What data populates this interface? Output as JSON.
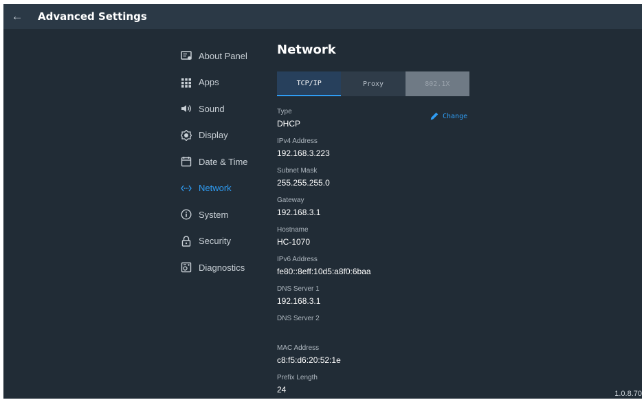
{
  "header": {
    "title": "Advanced Settings",
    "back_icon": "arrow-left-icon"
  },
  "sidebar": {
    "items": [
      {
        "label": "About Panel",
        "icon": "about-panel-icon"
      },
      {
        "label": "Apps",
        "icon": "apps-grid-icon"
      },
      {
        "label": "Sound",
        "icon": "speaker-icon"
      },
      {
        "label": "Display",
        "icon": "brightness-icon"
      },
      {
        "label": "Date & Time",
        "icon": "calendar-icon"
      },
      {
        "label": "Network",
        "icon": "network-icon",
        "active": true
      },
      {
        "label": "System",
        "icon": "info-icon"
      },
      {
        "label": "Security",
        "icon": "lock-icon"
      },
      {
        "label": "Diagnostics",
        "icon": "diagnostics-icon"
      }
    ]
  },
  "main": {
    "title": "Network",
    "tabs": [
      {
        "label": "TCP/IP",
        "selected": true
      },
      {
        "label": "Proxy"
      },
      {
        "label": "802.1X",
        "disabled": true
      }
    ],
    "change_label": "Change",
    "fields": [
      {
        "label": "Type",
        "value": "DHCP"
      },
      {
        "label": "IPv4 Address",
        "value": "192.168.3.223"
      },
      {
        "label": "Subnet Mask",
        "value": "255.255.255.0"
      },
      {
        "label": "Gateway",
        "value": "192.168.3.1"
      },
      {
        "label": "Hostname",
        "value": "HC-1070"
      },
      {
        "label": "IPv6 Address",
        "value": "fe80::8eff:10d5:a8f0:6baa"
      },
      {
        "label": "DNS Server 1",
        "value": "192.168.3.1"
      },
      {
        "label": "DNS Server 2",
        "value": ""
      },
      {
        "label": "MAC Address",
        "value": "c8:f5:d6:20:52:1e"
      },
      {
        "label": "Prefix Length",
        "value": "24"
      }
    ]
  },
  "footer": {
    "version": "1.0.8.70"
  },
  "colors": {
    "background": "#212c36",
    "topbar": "#2b3946",
    "accent": "#2f9df4",
    "tab_selected": "#27405c",
    "tab_default": "#2f3c49",
    "tab_disabled": "#6f7a85"
  }
}
